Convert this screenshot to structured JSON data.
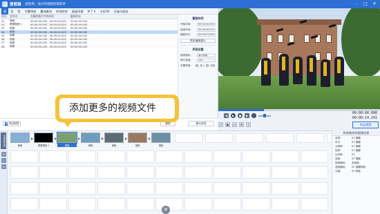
{
  "titlebar": {
    "app_name": "爱剪辑",
    "doc_title": "超轻简，强大的视频剪辑软件"
  },
  "menu": {
    "tabs": [
      "视",
      "音",
      "频",
      "字幕特效",
      "叠加素材",
      "转场特效",
      "画面风格",
      "M T V",
      "卡拉OK",
      "升级与服务"
    ],
    "active_index": 0
  },
  "subtitle_table": {
    "headers": [
      "序号",
      "文件名",
      "在最终影片中的时间",
      "截取时长"
    ],
    "rows": [
      {
        "idx": "01",
        "name": "视频",
        "time": "00:00:00.000 - 00:00:00.000",
        "dur": "00:00:00.000",
        "selected": false
      },
      {
        "idx": "02",
        "name": "黑屏视频 1",
        "time": "00:00:00.000 - 00:00:00.000",
        "dur": "00:00:00.000",
        "selected": false
      },
      {
        "idx": "03",
        "name": "视频",
        "time": "00:00:00.000 - 00:00:00.000",
        "dur": "00:00:00.000",
        "selected": false
      },
      {
        "idx": "04",
        "name": "视频",
        "time": "00:00:00.000 - 00:00:00.000",
        "dur": "00:00:00.000",
        "selected": true
      },
      {
        "idx": "05",
        "name": "视频",
        "time": "00:00:00.000 - 00:00:00.000",
        "dur": "00:00:00.000",
        "selected": false
      },
      {
        "idx": "06",
        "name": "视频",
        "time": "00:00:00.000 - 00:00:00.000",
        "dur": "00:00:00.000",
        "selected": false
      },
      {
        "idx": "07",
        "name": "视频",
        "time": "00:00:00.000 - 00:00:00.000",
        "dur": "00:00:00.000",
        "selected": false
      },
      {
        "idx": "08",
        "name": "视频",
        "time": "00:00:00.000 - 00:00:00.000",
        "dur": "00:00:00.000",
        "selected": false
      }
    ]
  },
  "props": {
    "group1": "截取时间",
    "start_label": "开始时间:",
    "start_value": "00:00:00.000",
    "end_label": "结束时间:",
    "end_value": "00:00:00.000",
    "dur_label": "截取时长:",
    "dur_value": "00:00:01.000",
    "pick_btn": "预览/截取原片",
    "group2": "声音设置",
    "track_label": "使用音轨:",
    "track_value": "原片音轨",
    "vol_label": "原片音量:",
    "vol_value": "100",
    "fade_label": "头尾声音:",
    "fade_in": "淡入",
    "fade_out": "淡出"
  },
  "toolbar": {
    "add_label": "添加视频",
    "delete_label": "删除",
    "confirm_label": "确认修改"
  },
  "callout": {
    "text": "添加更多的视频文件"
  },
  "preview": {
    "progress": 0.28
  },
  "player": {
    "time_current": "00:00:08.000",
    "time_total": "00:00:14.241",
    "volume": 0.5
  },
  "timeline": {
    "side_label": "已添加片段",
    "clips": [
      {
        "label": "视频",
        "selected": false,
        "color": "#88b0d6"
      },
      {
        "label": "黑屏视频 1",
        "selected": false,
        "color": "#000000"
      },
      {
        "label": "视频",
        "selected": true,
        "color": "#7aa06b"
      },
      {
        "label": "视频",
        "selected": false,
        "color": "#6f9dbf"
      },
      {
        "label": "视频",
        "selected": false,
        "color": "#5e6d74"
      },
      {
        "label": "视频",
        "selected": false,
        "color": "#9a7a5f"
      },
      {
        "label": "视频",
        "selected": false,
        "color": "#6d8fa6"
      }
    ]
  },
  "right_panel": {
    "export_label": "导出视频",
    "title": "所有制作的视频信息",
    "rows": [
      {
        "k": "名称:",
        "v": "07 视频"
      },
      {
        "k": "时长:",
        "v": "07 视频"
      },
      {
        "k": "分辨率:",
        "v": "07 视频"
      },
      {
        "k": "帧率:",
        "v": "07 视频"
      },
      {
        "k": "比特率:",
        "v": "07"
      },
      {
        "k": "音频:",
        "v": "07 视频"
      },
      {
        "k": "视频编码:",
        "v": "无特效"
      },
      {
        "k": "音频编码:",
        "v": "07 视频特效"
      },
      {
        "k": "字幕:",
        "v": "07 特效"
      }
    ]
  }
}
